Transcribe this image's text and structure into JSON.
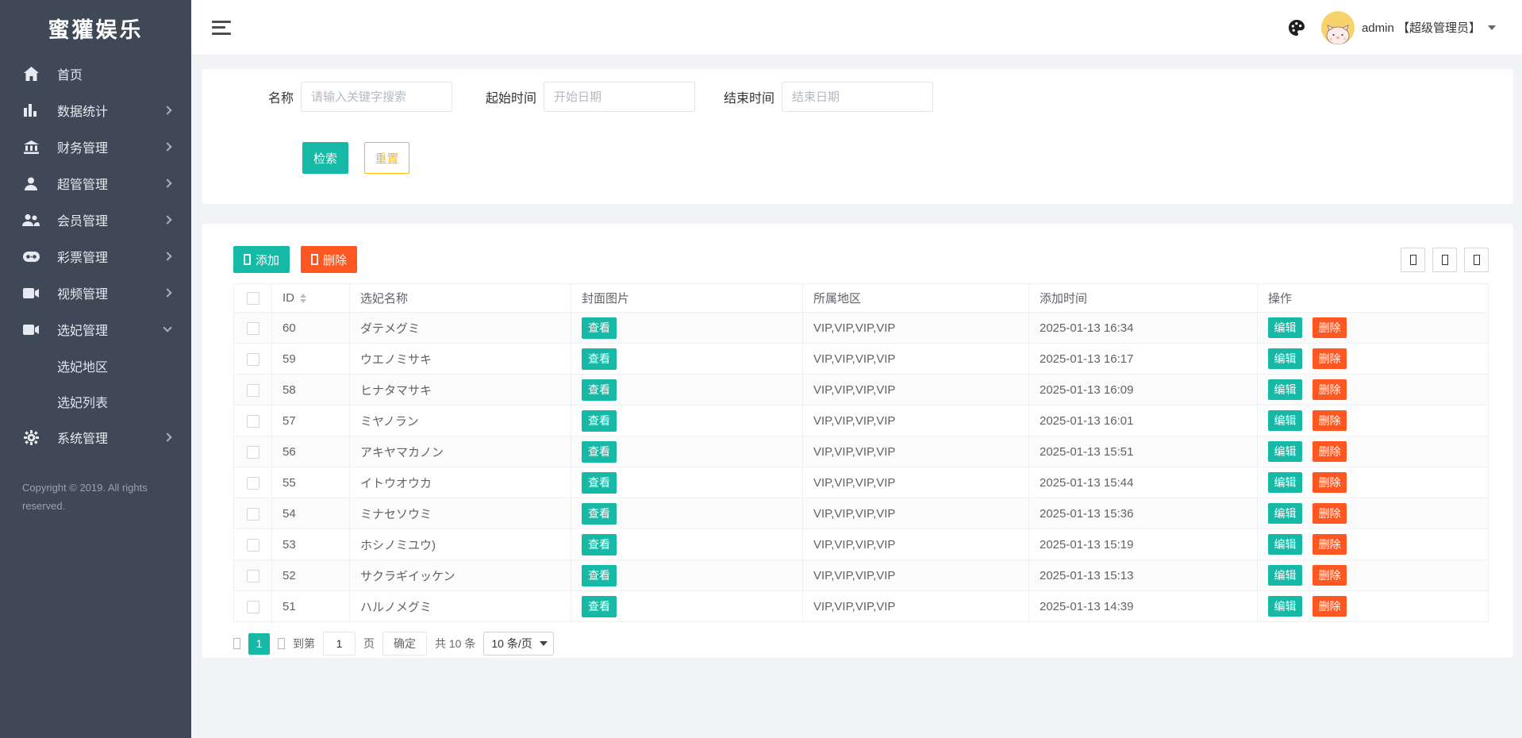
{
  "app": {
    "title": "蜜獾娱乐"
  },
  "colors": {
    "accent": "#16b9a6",
    "danger": "#ff5722",
    "warning": "#ffb800",
    "sidebar": "#3f4856",
    "avatar_bg": "#f7d26d"
  },
  "sidebar": {
    "items": [
      {
        "label": "首页",
        "icon": "home-icon"
      },
      {
        "label": "数据统计",
        "icon": "stats-icon"
      },
      {
        "label": "财务管理",
        "icon": "finance-icon"
      },
      {
        "label": "超管管理",
        "icon": "admin-icon"
      },
      {
        "label": "会员管理",
        "icon": "members-icon"
      },
      {
        "label": "彩票管理",
        "icon": "lottery-icon"
      },
      {
        "label": "视频管理",
        "icon": "video-icon"
      },
      {
        "label": "选妃管理",
        "icon": "consort-icon"
      },
      {
        "label": "系统管理",
        "icon": "system-icon"
      }
    ],
    "subitems": [
      {
        "label": "选妃地区"
      },
      {
        "label": "选妃列表"
      }
    ],
    "copyright": "Copyright © 2019. All rights reserved."
  },
  "header": {
    "user": "admin 【超级管理员】"
  },
  "search": {
    "name_label": "名称",
    "name_placeholder": "请输入关键字搜索",
    "start_label": "起始时间",
    "start_placeholder": "开始日期",
    "end_label": "结束时间",
    "end_placeholder": "结束日期",
    "search_button": "检索",
    "reset_button": "重置"
  },
  "toolbar": {
    "add_label": "添加",
    "delete_label": "删除"
  },
  "table": {
    "columns": {
      "id": "ID",
      "name": "选妃名称",
      "cover": "封面图片",
      "region": "所属地区",
      "time": "添加时间",
      "action": "操作"
    },
    "view_label": "查看",
    "edit_label": "编辑",
    "delete_label": "删除",
    "rows": [
      {
        "id": "60",
        "name": "ダテメグミ",
        "region": "VIP,VIP,VIP,VIP",
        "time": "2025-01-13 16:34"
      },
      {
        "id": "59",
        "name": "ウエノミサキ",
        "region": "VIP,VIP,VIP,VIP",
        "time": "2025-01-13 16:17"
      },
      {
        "id": "58",
        "name": "ヒナタマサキ",
        "region": "VIP,VIP,VIP,VIP",
        "time": "2025-01-13 16:09"
      },
      {
        "id": "57",
        "name": "ミヤノラン",
        "region": "VIP,VIP,VIP,VIP",
        "time": "2025-01-13 16:01"
      },
      {
        "id": "56",
        "name": "アキヤマカノン",
        "region": "VIP,VIP,VIP,VIP",
        "time": "2025-01-13 15:51"
      },
      {
        "id": "55",
        "name": "イトウオウカ",
        "region": "VIP,VIP,VIP,VIP",
        "time": "2025-01-13 15:44"
      },
      {
        "id": "54",
        "name": "ミナセソウミ",
        "region": "VIP,VIP,VIP,VIP",
        "time": "2025-01-13 15:36"
      },
      {
        "id": "53",
        "name": "ホシノミユウ)",
        "region": "VIP,VIP,VIP,VIP",
        "time": "2025-01-13 15:19"
      },
      {
        "id": "52",
        "name": "サクラギイッケン",
        "region": "VIP,VIP,VIP,VIP",
        "time": "2025-01-13 15:13"
      },
      {
        "id": "51",
        "name": "ハルノメグミ",
        "region": "VIP,VIP,VIP,VIP",
        "time": "2025-01-13 14:39"
      }
    ]
  },
  "pagination": {
    "current_page": "1",
    "goto_prefix": "到第",
    "goto_value": "1",
    "goto_suffix": "页",
    "confirm_label": "确定",
    "total_label": "共 10 条",
    "page_size": "10 条/页"
  }
}
